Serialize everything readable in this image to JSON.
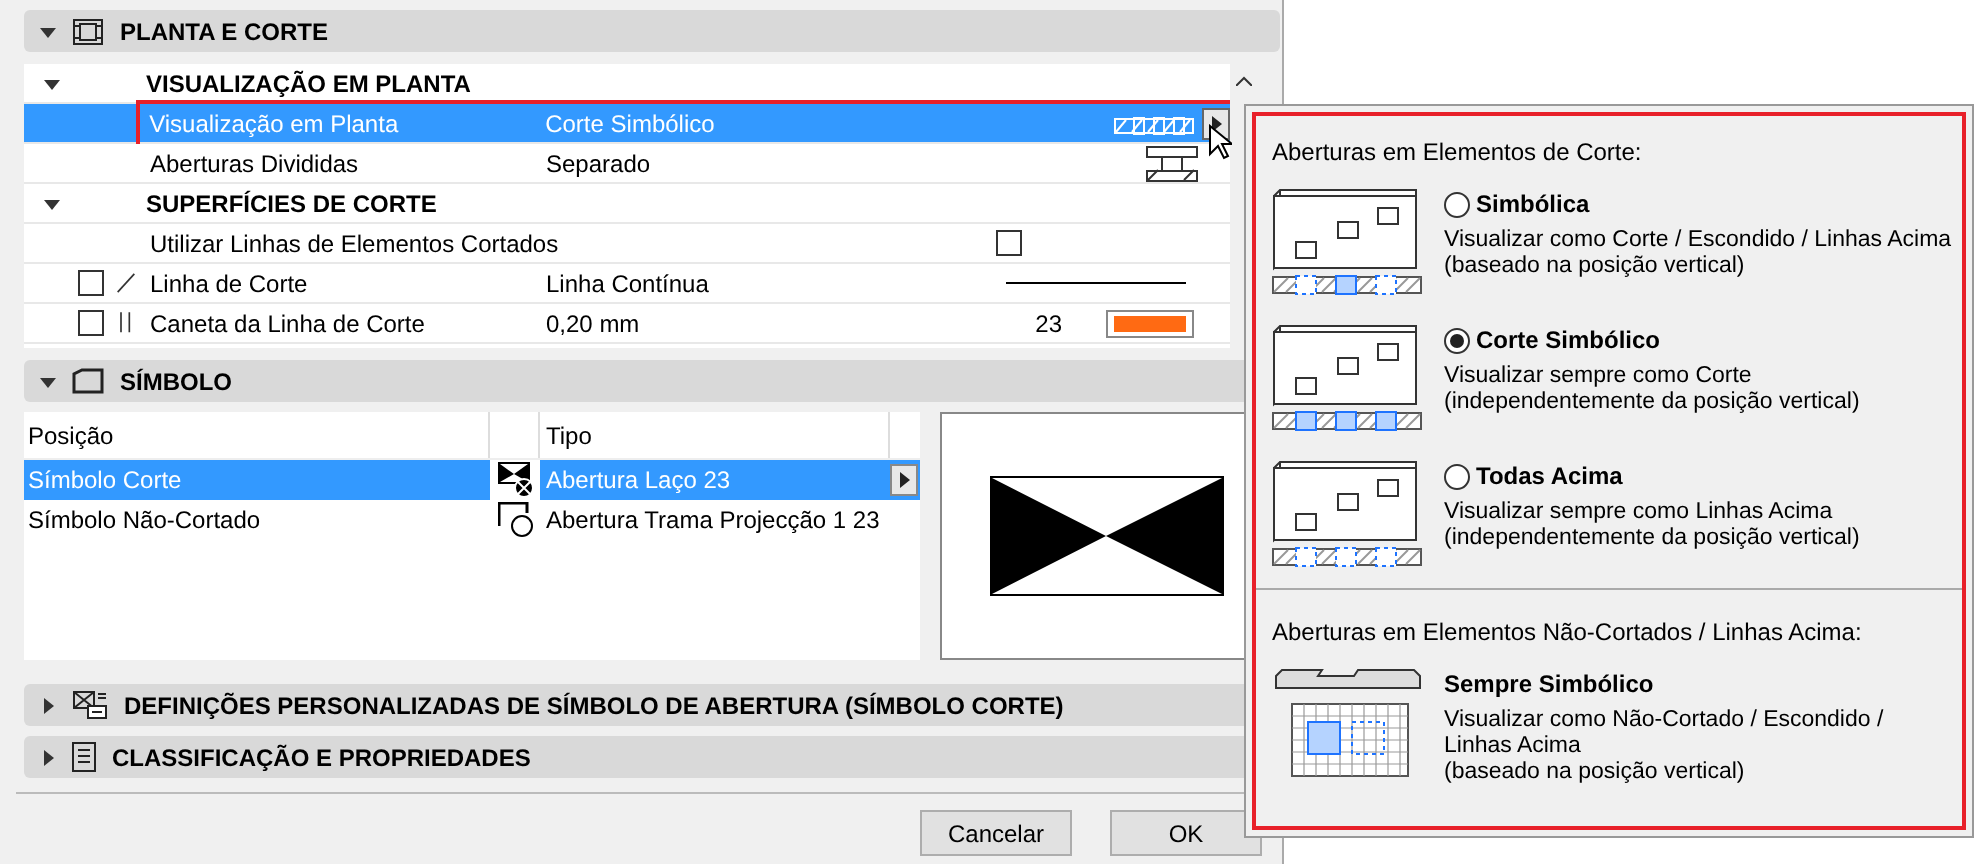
{
  "plan_section": {
    "title": "PLANTA E CORTE",
    "expanded": true,
    "groups": [
      {
        "title": "VISUALIZAÇÃO EM PLANTA",
        "expanded": true,
        "rows": [
          {
            "kind": "value",
            "label": "Visualização em Planta",
            "value": "Corte Simbólico",
            "selected": true
          },
          {
            "kind": "value",
            "label": "Aberturas Divididas",
            "value": "Separado",
            "selected": false
          }
        ]
      },
      {
        "title": "SUPERFÍCIES DE CORTE",
        "expanded": true,
        "rows": [
          {
            "kind": "check",
            "label": "Utilizar Linhas de Elementos Cortados",
            "checked": false,
            "selected": false
          },
          {
            "kind": "line",
            "label": "Linha de Corte",
            "value": "Linha Contínua",
            "checked": false,
            "selected": false
          },
          {
            "kind": "pen",
            "label": "Caneta da Linha de Corte",
            "value": "0,20 mm",
            "number": "23",
            "checked": false,
            "selected": false
          }
        ]
      }
    ]
  },
  "symbol_section": {
    "title": "SÍMBOLO",
    "expanded": true,
    "columns": [
      "Posição",
      "Tipo"
    ],
    "rows": [
      {
        "position": "Símbolo Corte",
        "type": "Abertura Laço 23",
        "selected": true
      },
      {
        "position": "Símbolo Não-Cortado",
        "type": "Abertura Trama Projecção 1 23",
        "selected": false
      }
    ]
  },
  "collapsed_sections": [
    {
      "title": "DEFINIÇÕES PERSONALIZADAS DE SÍMBOLO DE ABERTURA (SÍMBOLO CORTE)",
      "expanded": false
    },
    {
      "title": "CLASSIFICAÇÃO E PROPRIEDADES",
      "expanded": false
    }
  ],
  "buttons": [
    "Cancelar",
    "OK"
  ],
  "popup": {
    "groups": [
      {
        "title": "Aberturas em Elementos de Corte:",
        "options": [
          {
            "kind": "radio",
            "label": "Simbólica",
            "description": [
              "Visualizar como Corte / Escondido / Linhas Acima",
              "(baseado na posição vertical)"
            ],
            "selected": false
          },
          {
            "kind": "radio",
            "label": "Corte Simbólico",
            "description": [
              "Visualizar sempre como Corte",
              "(independentemente da posição vertical)"
            ],
            "selected": true
          },
          {
            "kind": "radio",
            "label": "Todas Acima",
            "description": [
              "Visualizar sempre como Linhas Acima",
              "(independentemente da posição vertical)"
            ],
            "selected": false
          }
        ]
      },
      {
        "title": "Aberturas em Elementos Não-Cortados / Linhas Acima:",
        "options": [
          {
            "kind": "fixed",
            "label": "Sempre Simbólico",
            "description": [
              "Visualizar como Não-Cortado / Escondido /",
              "Linhas Acima",
              "(baseado na posição vertical)"
            ]
          }
        ]
      }
    ]
  }
}
